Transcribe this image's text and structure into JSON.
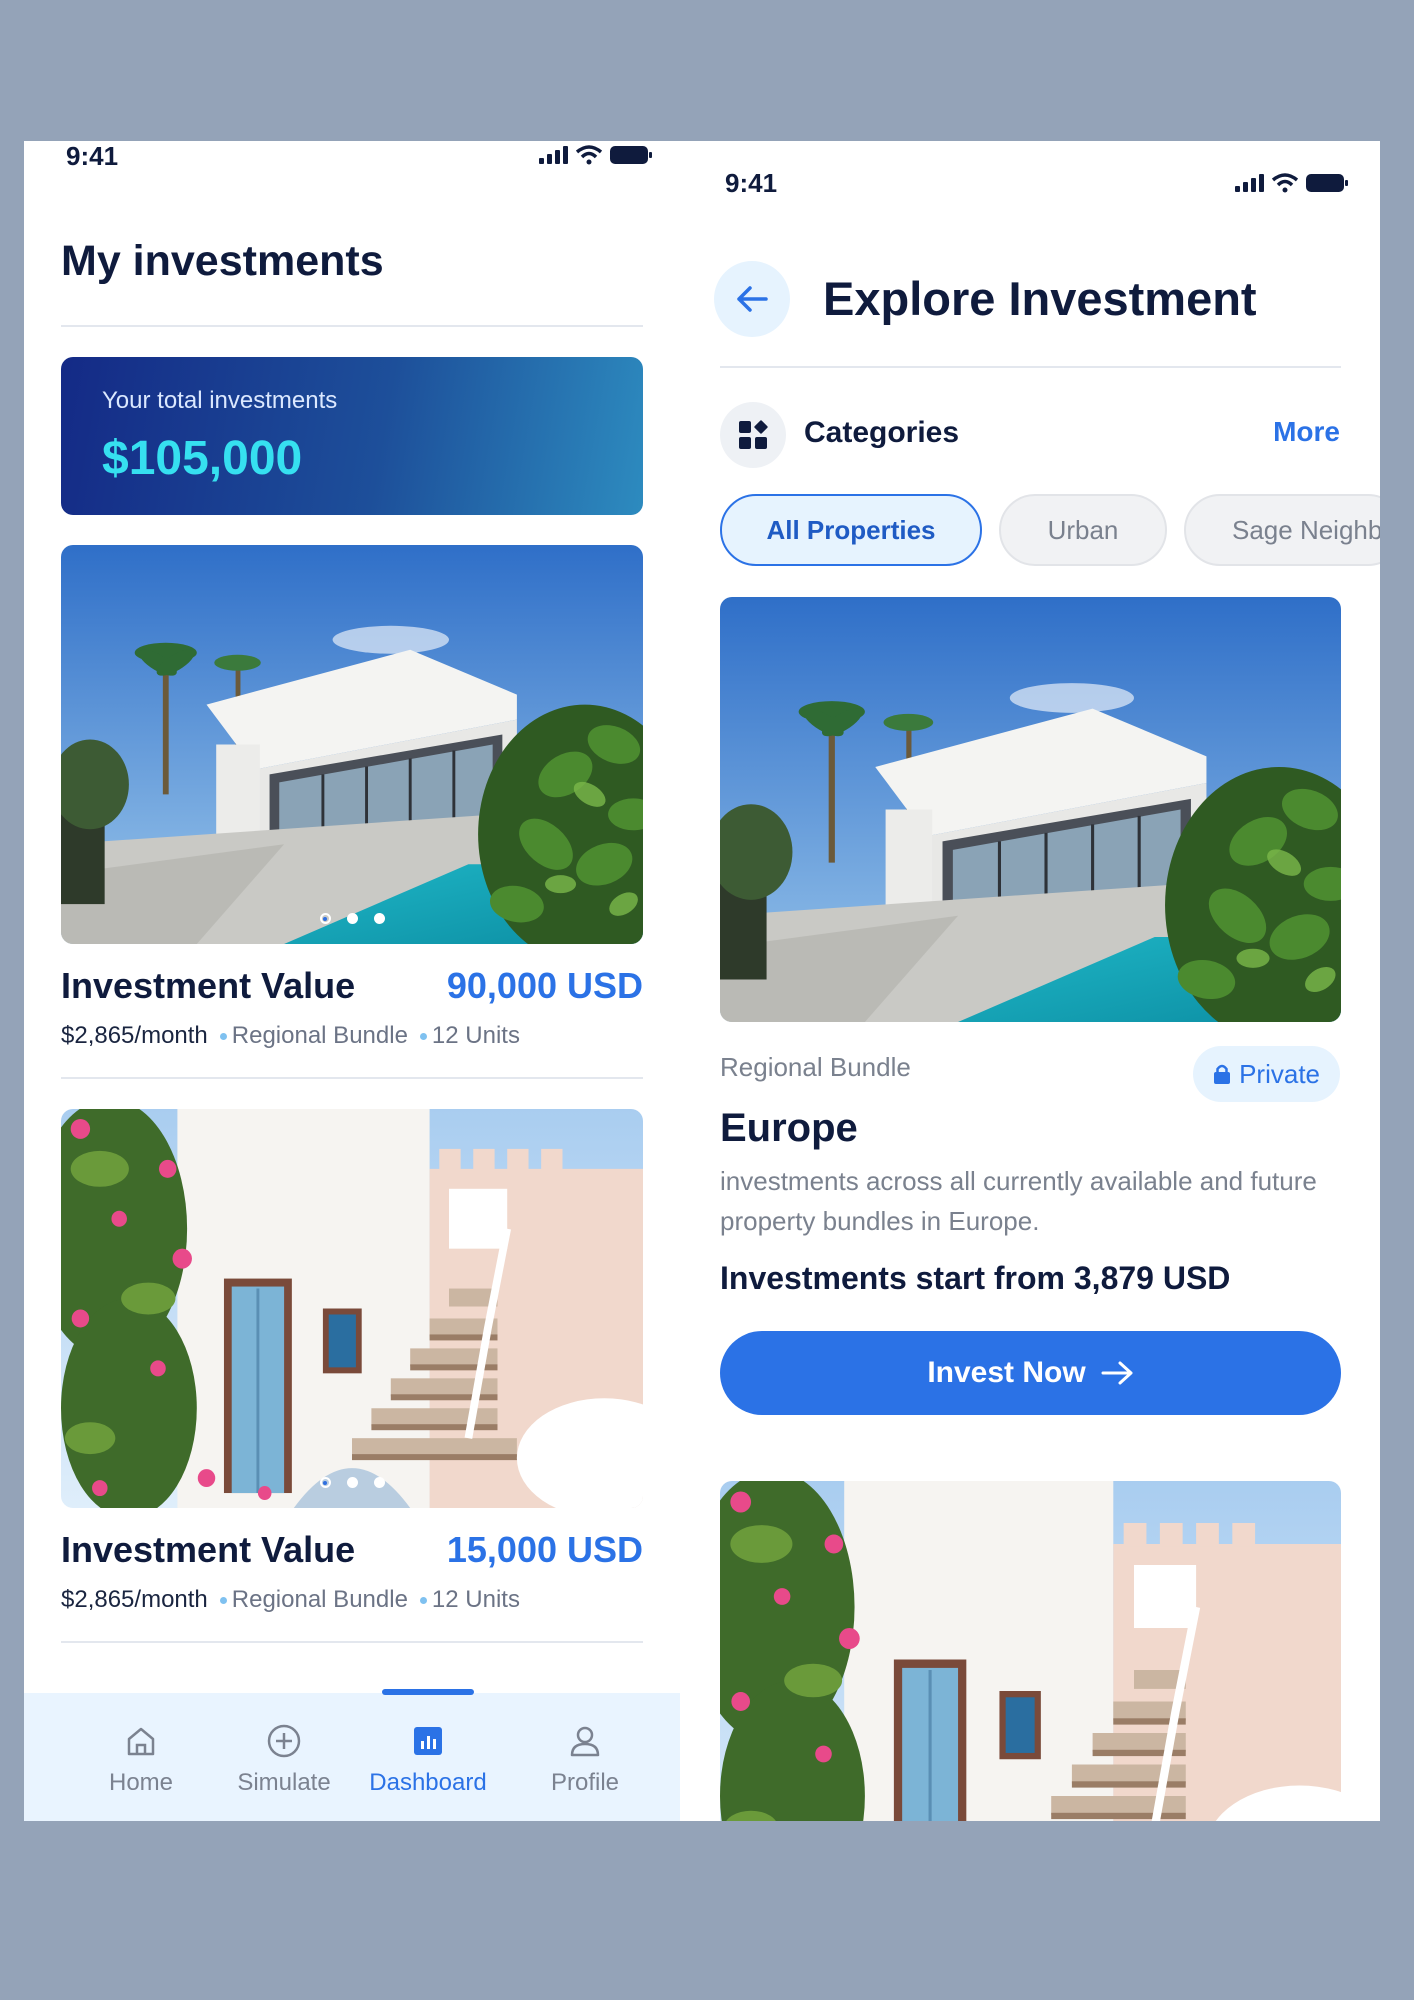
{
  "status_bar": {
    "time": "9:41"
  },
  "my_investments": {
    "title": "My investments",
    "total": {
      "label": "Your total investments",
      "value": "$105,000"
    },
    "items": [
      {
        "title": "Investment Value",
        "value": "90,000 USD",
        "monthly": "$2,865/month",
        "bundle": "Regional Bundle",
        "units": "12 Units",
        "image": "modern-villa-with-pool",
        "slides": 3,
        "active_slide": 1
      },
      {
        "title": "Investment Value",
        "value": "15,000 USD",
        "monthly": "$2,865/month",
        "bundle": "Regional Bundle",
        "units": "12 Units",
        "image": "whitewashed-mediterranean-house",
        "slides": 3,
        "active_slide": 1
      }
    ]
  },
  "tabbar": {
    "items": [
      {
        "label": "Home",
        "icon": "home-icon"
      },
      {
        "label": "Simulate",
        "icon": "plus-circle-icon"
      },
      {
        "label": "Dashboard",
        "icon": "bar-chart-icon",
        "active": true
      },
      {
        "label": "Profile",
        "icon": "user-icon"
      }
    ]
  },
  "explore": {
    "title": "Explore Investment",
    "categories_label": "Categories",
    "more_label": "More",
    "chips": [
      "All Properties",
      "Urban",
      "Sage Neighb"
    ],
    "bundle": "Regional Bundle",
    "private_label": "Private",
    "name": "Europe",
    "description": "investments across all currently available and future property bundles in Europe.",
    "start_text": "Investments start from 3,879 USD",
    "cta": "Invest Now"
  },
  "colors": {
    "accent": "#2b72e6",
    "navy": "#0f1b3d",
    "card_gradient_start": "#142a86",
    "card_gradient_end": "#2d8bbf",
    "highlight": "#36e0f0"
  }
}
